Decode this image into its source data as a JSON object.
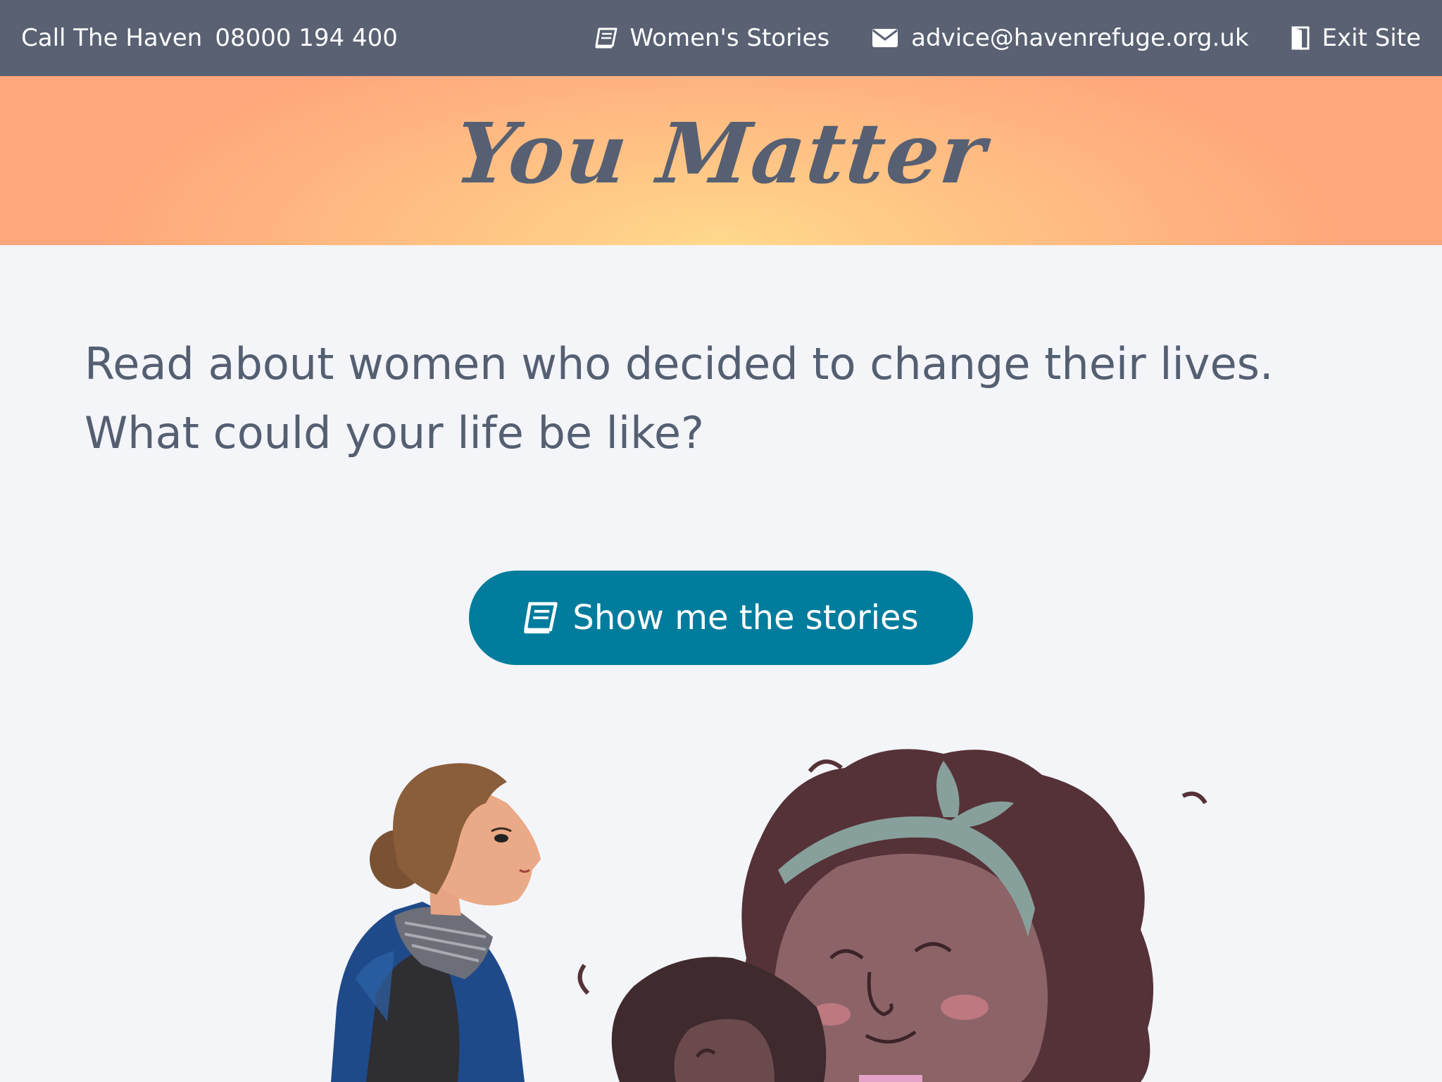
{
  "topbar": {
    "call_label": "Call The Haven",
    "phone": "08000 194 400",
    "nav": [
      {
        "label": "Women's Stories",
        "icon": "book-icon"
      },
      {
        "label": "advice@havenrefuge.org.uk",
        "icon": "envelope-icon"
      },
      {
        "label": "Exit Site",
        "icon": "door-icon"
      }
    ]
  },
  "hero": {
    "title": "You Matter"
  },
  "intro": {
    "text": "Read about women who decided to change their lives. What could your life be like?"
  },
  "cta": {
    "label": "Show me the stories",
    "icon": "book-icon"
  },
  "colors": {
    "topbar_bg": "#596173",
    "hero_gradient_center": "#ffd98c",
    "hero_gradient_edge": "#ffa67c",
    "button_bg": "#017c9c",
    "text": "#555f72",
    "page_bg": "#f4f5f9"
  }
}
